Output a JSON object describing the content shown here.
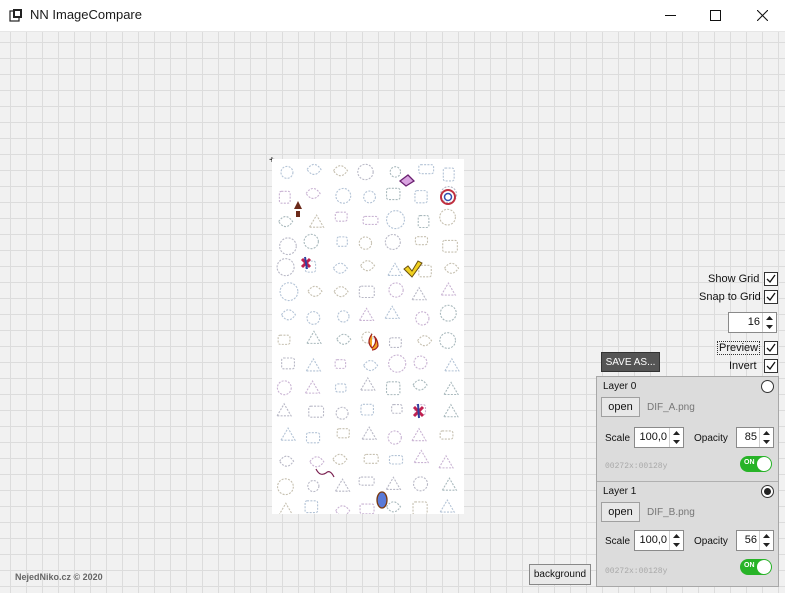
{
  "window": {
    "title": "NN ImageCompare",
    "controls": [
      "minimize-icon",
      "maximize-icon",
      "close-icon"
    ]
  },
  "canvas": {
    "crosshair": "+",
    "grid_visible": true
  },
  "options": {
    "show_grid_label": "Show Grid",
    "show_grid_checked": true,
    "snap_label": "Snap to Grid",
    "snap_checked": true,
    "grid_size": "16",
    "preview_label": "Preview",
    "preview_checked": true,
    "invert_label": "Invert",
    "invert_checked": true,
    "save_as_label": "SAVE AS..."
  },
  "layers": [
    {
      "name": "Layer 0",
      "active": false,
      "open_label": "open",
      "file": "DIF_A.png",
      "scale_label": "Scale",
      "scale": "100,0",
      "opacity_label": "Opacity",
      "opacity": "85",
      "coords": "00272x:00128y",
      "toggle": "ON"
    },
    {
      "name": "Layer 1",
      "active": true,
      "open_label": "open",
      "file": "DIF_B.png",
      "scale_label": "Scale",
      "scale": "100,0",
      "opacity_label": "Opacity",
      "opacity": "56",
      "coords": "00272x:00128y",
      "toggle": "ON"
    }
  ],
  "background_label": "background",
  "footer": "NejedNiko.cz © 2020",
  "colors": {
    "toggle_on": "#27b327",
    "save_button": "#555555"
  }
}
